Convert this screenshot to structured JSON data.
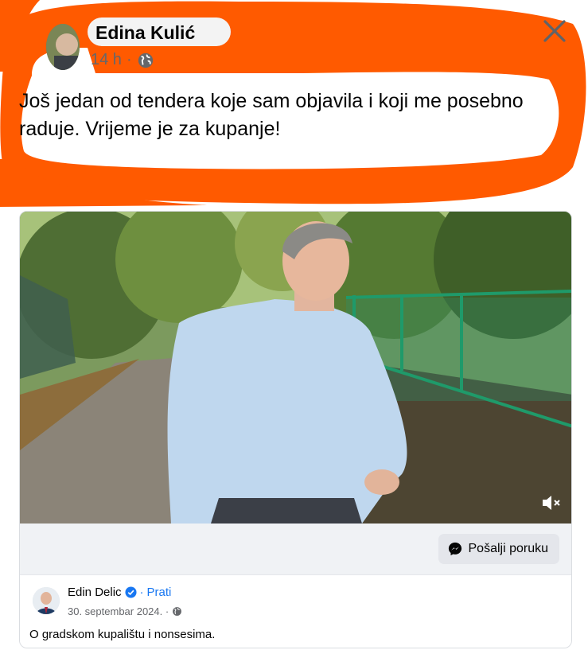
{
  "post": {
    "author": "Edina Kulić",
    "time": "14 h",
    "separator": "·",
    "text": "Još jedan od tendera koje sam objavila i koji me posebno raduje. Vrijeme je za kupanje!"
  },
  "icons": {
    "close": "close-icon",
    "audience": "globe-icon",
    "mute": "muted-speaker-icon",
    "messenger": "messenger-icon",
    "verified": "verified-badge-icon"
  },
  "shared": {
    "send_label": "Pošalji poruku",
    "source_name": "Edin Delic",
    "dot": "·",
    "follow": "Prati",
    "date": "30. septembar 2024. ·",
    "caption": "O gradskom kupalištu i nonsesima."
  },
  "colors": {
    "scribble": "#ff5a00",
    "link": "#1877f2",
    "muted_text": "#65676b"
  }
}
